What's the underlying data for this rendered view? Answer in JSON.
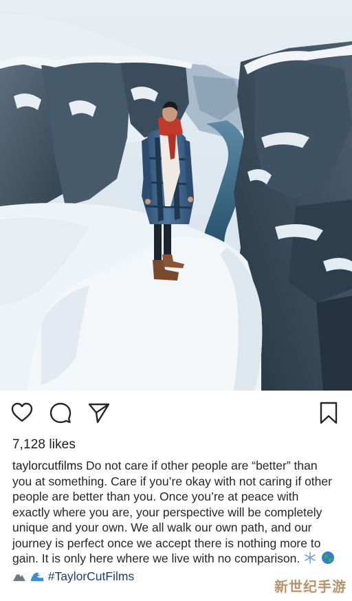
{
  "post": {
    "likes_text": "7,128 likes",
    "username": "taylorcutfilms",
    "caption_text": "Do not care if other people are “better” than you at something. Care if you’re okay with not caring if other people are better than you. Once you’re at peace with exactly where you are, your perspective will be completely unique and your own. We all walk our own path, and our journey is perfect once we accept there is nothing more to gain. It is only here where we live with no comparison.",
    "hashtag": "#TaylorCutFilms",
    "emojis": [
      "snowflake-emoji",
      "globe-emoji",
      "mountain-emoji",
      "wave-emoji"
    ]
  },
  "actions": {
    "like_icon": "heart-icon",
    "comment_icon": "comment-icon",
    "share_icon": "paper-plane-icon",
    "save_icon": "bookmark-icon"
  },
  "watermark": {
    "text": "新世纪手游"
  },
  "colors": {
    "snow": "#eef3f8",
    "rock": "#3c4e5e",
    "river": "#2e5f7a",
    "sky": "#dfe8f0"
  }
}
